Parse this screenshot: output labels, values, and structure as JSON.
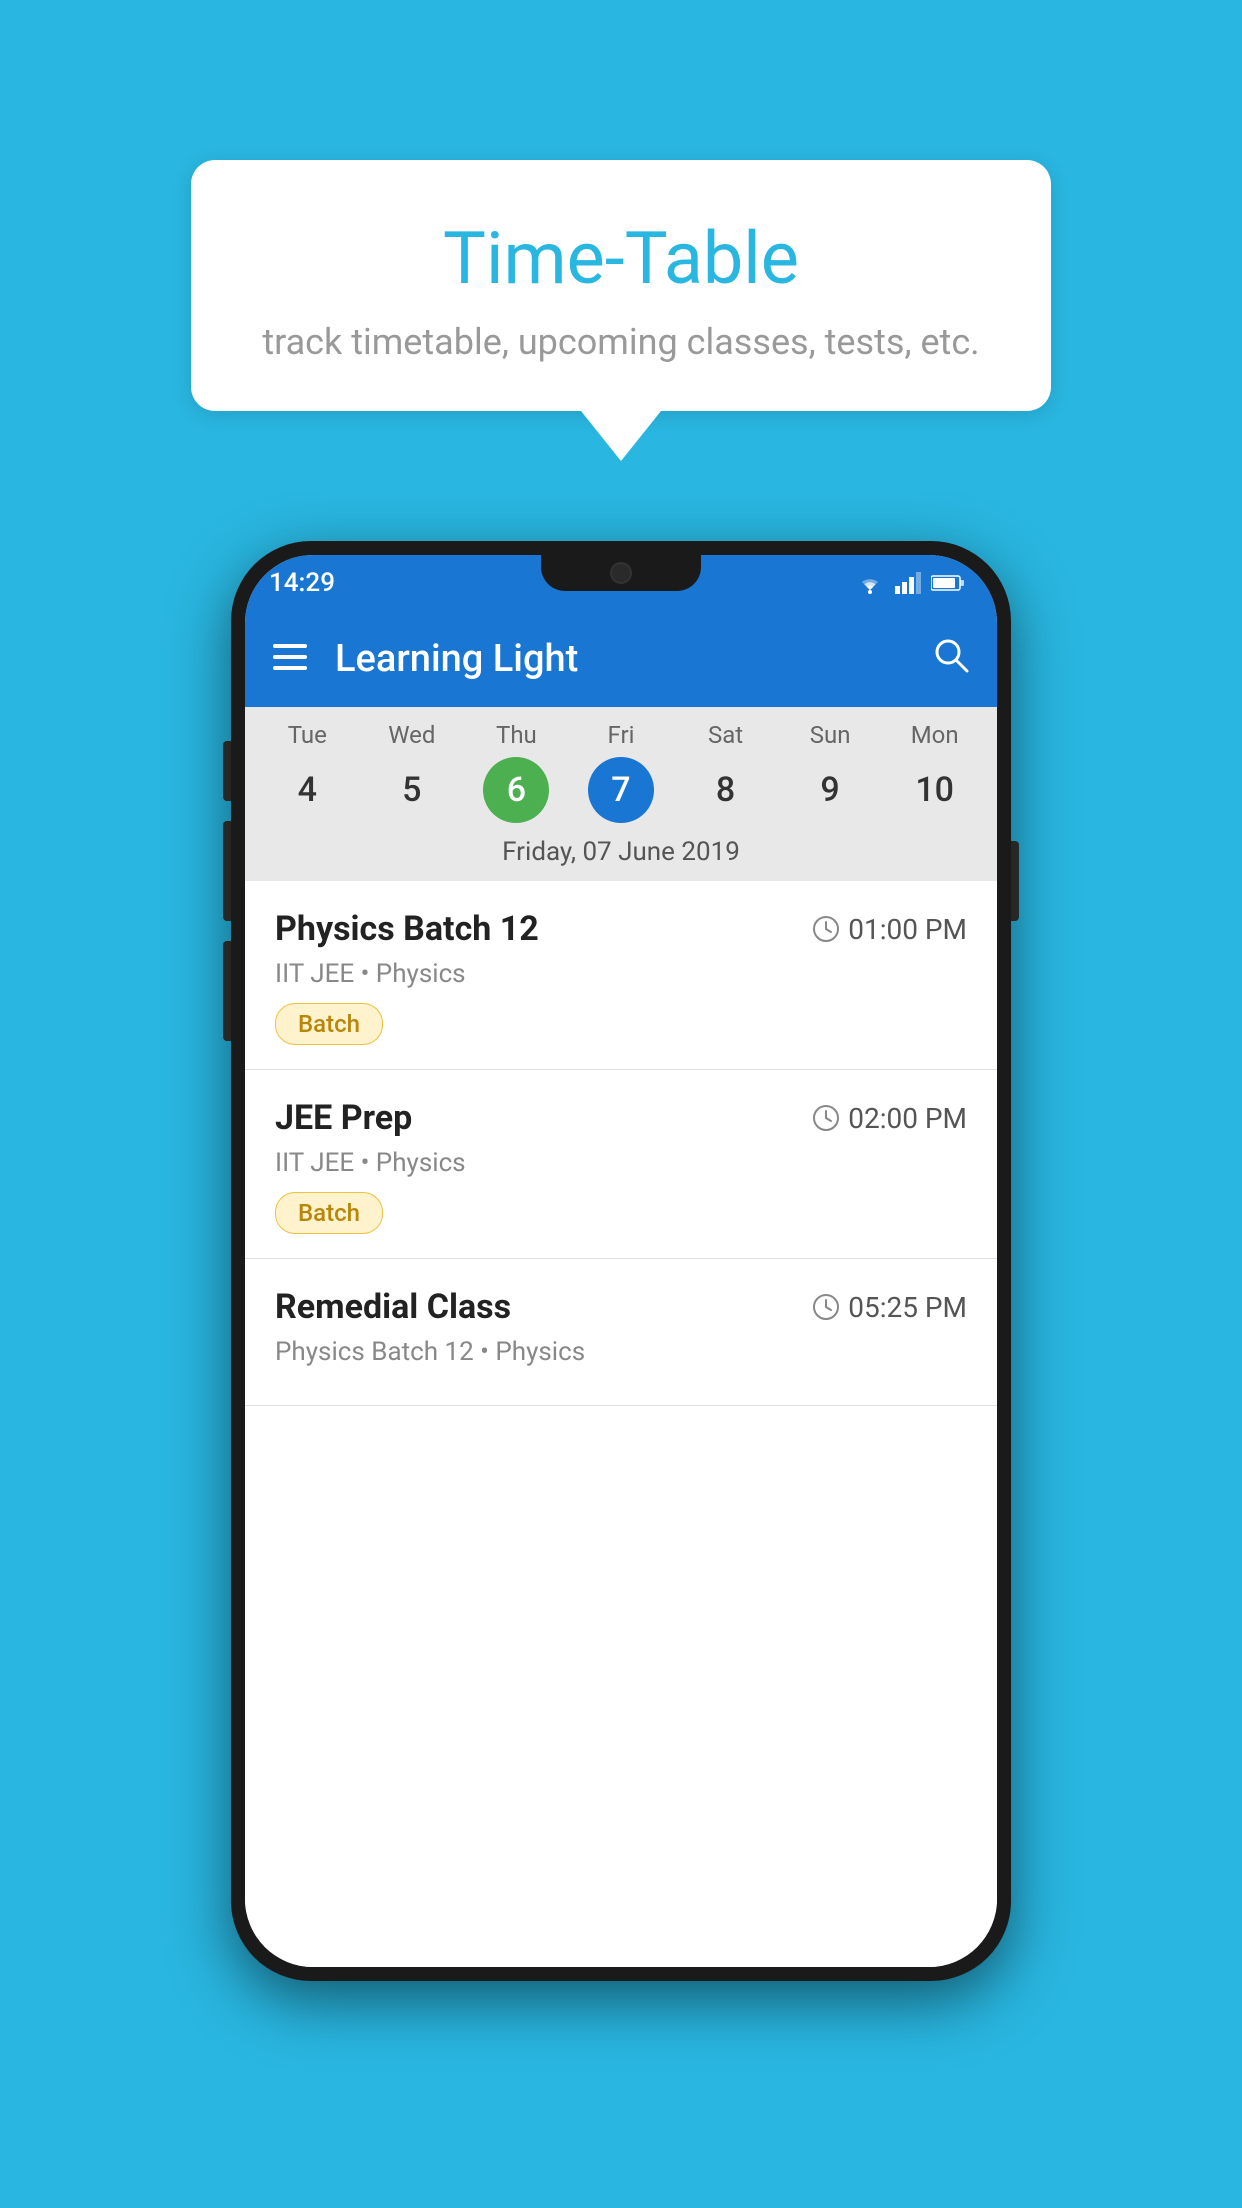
{
  "background_color": "#29B6E0",
  "speech_bubble": {
    "title": "Time-Table",
    "subtitle": "track timetable, upcoming classes, tests, etc."
  },
  "phone": {
    "status_bar": {
      "time": "14:29"
    },
    "app_bar": {
      "title": "Learning Light"
    },
    "calendar": {
      "days": [
        {
          "label": "Tue",
          "number": "4",
          "state": "normal"
        },
        {
          "label": "Wed",
          "number": "5",
          "state": "normal"
        },
        {
          "label": "Thu",
          "number": "6",
          "state": "today"
        },
        {
          "label": "Fri",
          "number": "7",
          "state": "selected"
        },
        {
          "label": "Sat",
          "number": "8",
          "state": "normal"
        },
        {
          "label": "Sun",
          "number": "9",
          "state": "normal"
        },
        {
          "label": "Mon",
          "number": "10",
          "state": "normal"
        }
      ],
      "selected_date_label": "Friday, 07 June 2019"
    },
    "schedule_items": [
      {
        "title": "Physics Batch 12",
        "time": "01:00 PM",
        "subtitle": "IIT JEE • Physics",
        "badge": "Batch"
      },
      {
        "title": "JEE Prep",
        "time": "02:00 PM",
        "subtitle": "IIT JEE • Physics",
        "badge": "Batch"
      },
      {
        "title": "Remedial Class",
        "time": "05:25 PM",
        "subtitle": "Physics Batch 12 • Physics",
        "badge": null
      }
    ]
  }
}
